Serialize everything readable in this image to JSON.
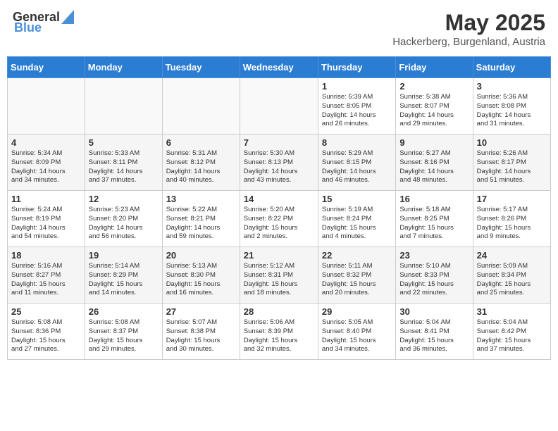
{
  "header": {
    "logo_general": "General",
    "logo_blue": "Blue",
    "month_year": "May 2025",
    "location": "Hackerberg, Burgenland, Austria"
  },
  "days_of_week": [
    "Sunday",
    "Monday",
    "Tuesday",
    "Wednesday",
    "Thursday",
    "Friday",
    "Saturday"
  ],
  "weeks": [
    [
      {
        "day": "",
        "info": ""
      },
      {
        "day": "",
        "info": ""
      },
      {
        "day": "",
        "info": ""
      },
      {
        "day": "",
        "info": ""
      },
      {
        "day": "1",
        "info": "Sunrise: 5:39 AM\nSunset: 8:05 PM\nDaylight: 14 hours\nand 26 minutes."
      },
      {
        "day": "2",
        "info": "Sunrise: 5:38 AM\nSunset: 8:07 PM\nDaylight: 14 hours\nand 29 minutes."
      },
      {
        "day": "3",
        "info": "Sunrise: 5:36 AM\nSunset: 8:08 PM\nDaylight: 14 hours\nand 31 minutes."
      }
    ],
    [
      {
        "day": "4",
        "info": "Sunrise: 5:34 AM\nSunset: 8:09 PM\nDaylight: 14 hours\nand 34 minutes."
      },
      {
        "day": "5",
        "info": "Sunrise: 5:33 AM\nSunset: 8:11 PM\nDaylight: 14 hours\nand 37 minutes."
      },
      {
        "day": "6",
        "info": "Sunrise: 5:31 AM\nSunset: 8:12 PM\nDaylight: 14 hours\nand 40 minutes."
      },
      {
        "day": "7",
        "info": "Sunrise: 5:30 AM\nSunset: 8:13 PM\nDaylight: 14 hours\nand 43 minutes."
      },
      {
        "day": "8",
        "info": "Sunrise: 5:29 AM\nSunset: 8:15 PM\nDaylight: 14 hours\nand 46 minutes."
      },
      {
        "day": "9",
        "info": "Sunrise: 5:27 AM\nSunset: 8:16 PM\nDaylight: 14 hours\nand 48 minutes."
      },
      {
        "day": "10",
        "info": "Sunrise: 5:26 AM\nSunset: 8:17 PM\nDaylight: 14 hours\nand 51 minutes."
      }
    ],
    [
      {
        "day": "11",
        "info": "Sunrise: 5:24 AM\nSunset: 8:19 PM\nDaylight: 14 hours\nand 54 minutes."
      },
      {
        "day": "12",
        "info": "Sunrise: 5:23 AM\nSunset: 8:20 PM\nDaylight: 14 hours\nand 56 minutes."
      },
      {
        "day": "13",
        "info": "Sunrise: 5:22 AM\nSunset: 8:21 PM\nDaylight: 14 hours\nand 59 minutes."
      },
      {
        "day": "14",
        "info": "Sunrise: 5:20 AM\nSunset: 8:22 PM\nDaylight: 15 hours\nand 2 minutes."
      },
      {
        "day": "15",
        "info": "Sunrise: 5:19 AM\nSunset: 8:24 PM\nDaylight: 15 hours\nand 4 minutes."
      },
      {
        "day": "16",
        "info": "Sunrise: 5:18 AM\nSunset: 8:25 PM\nDaylight: 15 hours\nand 7 minutes."
      },
      {
        "day": "17",
        "info": "Sunrise: 5:17 AM\nSunset: 8:26 PM\nDaylight: 15 hours\nand 9 minutes."
      }
    ],
    [
      {
        "day": "18",
        "info": "Sunrise: 5:16 AM\nSunset: 8:27 PM\nDaylight: 15 hours\nand 11 minutes."
      },
      {
        "day": "19",
        "info": "Sunrise: 5:14 AM\nSunset: 8:29 PM\nDaylight: 15 hours\nand 14 minutes."
      },
      {
        "day": "20",
        "info": "Sunrise: 5:13 AM\nSunset: 8:30 PM\nDaylight: 15 hours\nand 16 minutes."
      },
      {
        "day": "21",
        "info": "Sunrise: 5:12 AM\nSunset: 8:31 PM\nDaylight: 15 hours\nand 18 minutes."
      },
      {
        "day": "22",
        "info": "Sunrise: 5:11 AM\nSunset: 8:32 PM\nDaylight: 15 hours\nand 20 minutes."
      },
      {
        "day": "23",
        "info": "Sunrise: 5:10 AM\nSunset: 8:33 PM\nDaylight: 15 hours\nand 22 minutes."
      },
      {
        "day": "24",
        "info": "Sunrise: 5:09 AM\nSunset: 8:34 PM\nDaylight: 15 hours\nand 25 minutes."
      }
    ],
    [
      {
        "day": "25",
        "info": "Sunrise: 5:08 AM\nSunset: 8:36 PM\nDaylight: 15 hours\nand 27 minutes."
      },
      {
        "day": "26",
        "info": "Sunrise: 5:08 AM\nSunset: 8:37 PM\nDaylight: 15 hours\nand 29 minutes."
      },
      {
        "day": "27",
        "info": "Sunrise: 5:07 AM\nSunset: 8:38 PM\nDaylight: 15 hours\nand 30 minutes."
      },
      {
        "day": "28",
        "info": "Sunrise: 5:06 AM\nSunset: 8:39 PM\nDaylight: 15 hours\nand 32 minutes."
      },
      {
        "day": "29",
        "info": "Sunrise: 5:05 AM\nSunset: 8:40 PM\nDaylight: 15 hours\nand 34 minutes."
      },
      {
        "day": "30",
        "info": "Sunrise: 5:04 AM\nSunset: 8:41 PM\nDaylight: 15 hours\nand 36 minutes."
      },
      {
        "day": "31",
        "info": "Sunrise: 5:04 AM\nSunset: 8:42 PM\nDaylight: 15 hours\nand 37 minutes."
      }
    ]
  ]
}
